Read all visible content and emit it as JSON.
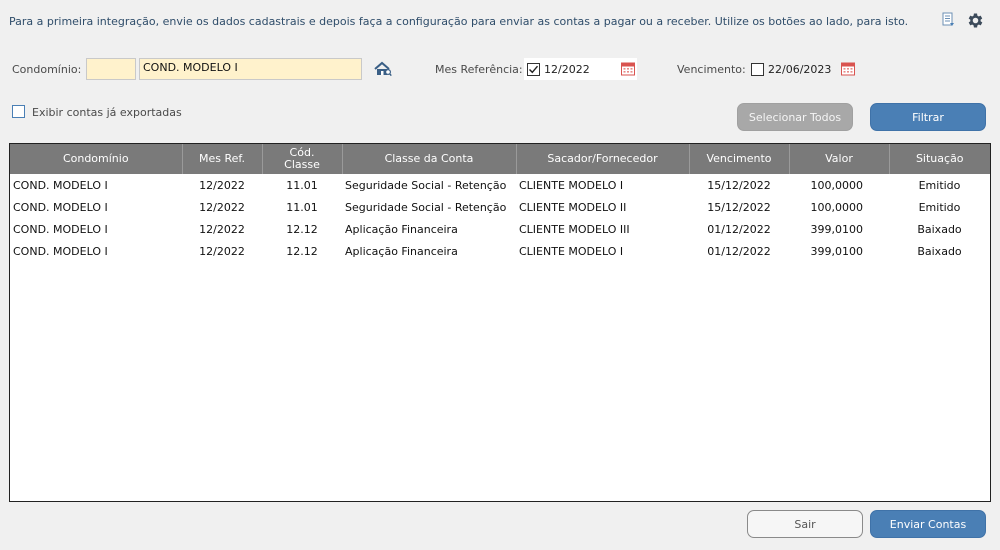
{
  "info": "Para a primeira integração, envie os dados cadastrais e depois faça a configuração para enviar as contas a pagar ou a receber. Utilize os botões ao lado, para isto.",
  "filters": {
    "condominio_label": "Condomínio:",
    "condominio_value": "COND. MODELO I",
    "mes_ref_label": "Mes Referência:",
    "mes_ref_value": "12/2022",
    "mes_ref_checked": true,
    "vencimento_label": "Vencimento:",
    "vencimento_value": "22/06/2023",
    "vencimento_checked": false,
    "exibir_label": "Exibir contas já exportadas"
  },
  "buttons": {
    "selecionar_todos": "Selecionar Todos",
    "filtrar": "Filtrar",
    "sair": "Sair",
    "enviar_contas": "Enviar Contas"
  },
  "icons": {
    "doc": "document-icon",
    "gear": "gear-icon",
    "search": "house-search-icon",
    "calendar": "calendar-icon"
  },
  "colors": {
    "accent": "#4a7fb5",
    "header_bg": "#7a7a7a",
    "field_bg": "#fff2cc",
    "calendar": "#d9534f"
  },
  "table": {
    "columns": [
      "Condomínio",
      "Mes Ref.",
      "Cód. Classe",
      "Classe da Conta",
      "Sacador/Fornecedor",
      "Vencimento",
      "Valor",
      "Situação"
    ],
    "rows": [
      [
        "COND. MODELO I",
        "12/2022",
        "11.01",
        "Seguridade Social - Retenção",
        "CLIENTE MODELO I",
        "15/12/2022",
        "100,0000",
        "Emitido"
      ],
      [
        "COND. MODELO I",
        "12/2022",
        "11.01",
        "Seguridade Social - Retenção",
        "CLIENTE MODELO II",
        "15/12/2022",
        "100,0000",
        "Emitido"
      ],
      [
        "COND. MODELO I",
        "12/2022",
        "12.12",
        "Aplicação Financeira",
        "CLIENTE MODELO III",
        "01/12/2022",
        "399,0100",
        "Baixado"
      ],
      [
        "COND. MODELO I",
        "12/2022",
        "12.12",
        "Aplicação Financeira",
        "CLIENTE MODELO I",
        "01/12/2022",
        "399,0100",
        "Baixado"
      ]
    ]
  }
}
